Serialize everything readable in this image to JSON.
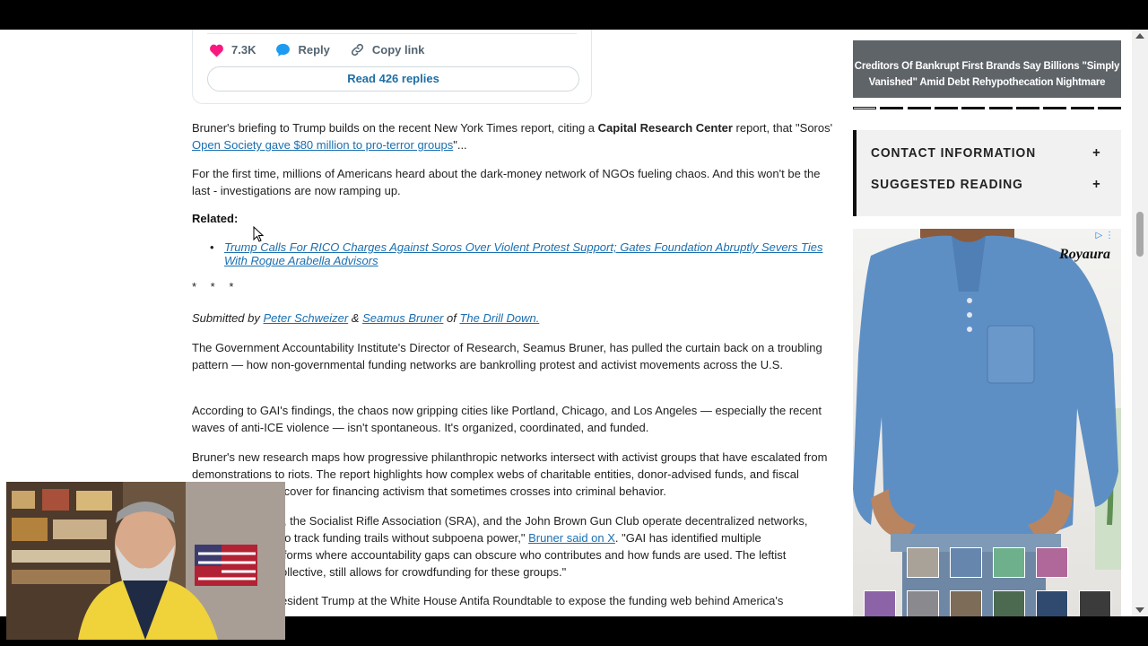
{
  "tweet": {
    "likes_count": "7.3K",
    "reply_label": "Reply",
    "copy_link_label": "Copy link",
    "read_replies_label": "Read 426 replies"
  },
  "article": {
    "p1_text_a": "Bruner's briefing to Trump builds on the recent New York Times report, citing a ",
    "p1_bold": "Capital Research Center",
    "p1_text_b": " report, that \"Soros'",
    "p1_link": " Open Society gave $80 million to pro-terror groups",
    "p1_text_c": "\"...",
    "p2": "For the first time, millions of Americans heard about the dark-money network of NGOs fueling chaos. And this won't be the last - investigations are now ramping up.",
    "related_label": "Related:",
    "related_bullet": "•",
    "related_link": "Trump Calls For RICO Charges Against Soros Over Violent Protest Support; Gates Foundation Abruptly Severs Ties With Rogue Arabella Advisors",
    "separator": "* * *",
    "submitted_prefix": "Submitted by ",
    "author1": "Peter Schweizer",
    "amp": " & ",
    "author2": "Seamus Bruner",
    "of": " of ",
    "outlet": "The Drill Down.",
    "p3": "The Government Accountability Institute's Director of Research, Seamus Bruner, has pulled the curtain back on a troubling pattern — how non-governmental funding networks are bankrolling protest and activist movements across the U.S.",
    "p4": "According to GAI's findings, the chaos now gripping cities like Portland, Chicago, and Los Angeles — especially the recent waves of anti-ICE violence — isn't spontaneous. It's organized, coordinated, and funded.",
    "p5": "Bruner's new research maps how progressive philanthropic networks intersect with activist groups that have escalated from demonstrations to riots. The report highlights how complex webs of charitable entities, donor-advised funds, and fiscal sponsors provide cover for financing activism that sometimes crosses into criminal behavior.",
    "p6_a": "Groups like Antifa, the Socialist Rifle Association (SRA), and the John Brown Gun Club operate decentralized networks, making it difficult to track funding trails without subpoena power,\" ",
    "p6_link": "Bruner said on X",
    "p6_b": ". \"GAI has identified multiple crowdfunding platforms where accountability gaps can obscure who contributes and how funds are used. The leftist platform, Open Collective, still allows for crowdfunding for these groups.\"",
    "p7": "Bruner briefed President Trump at the White House Antifa Roundtable to expose the funding web behind America's"
  },
  "sidebar": {
    "promo_headline": "Creditors Of Bankrupt First Brands Say Billions \"Simply Vanished\" Amid Debt Rehypothecation Nightmare",
    "accordion": [
      {
        "label": "CONTACT INFORMATION",
        "toggle": "+"
      },
      {
        "label": "SUGGESTED READING",
        "toggle": "+"
      }
    ],
    "ad": {
      "brand": "Royaura",
      "adchoices": "▷ ⋮",
      "swatch_colors": [
        "#a9a299",
        "#6786ad",
        "#6fb08c",
        "#b0679a",
        "#8d63a8",
        "#8a8a8e",
        "#7d6c58",
        "#4c6a50",
        "#2f4a6e",
        "#3b3b3b"
      ]
    }
  },
  "colors": {
    "link": "#1a6fb0",
    "like_heart": "#f91880",
    "reply_bubble": "#1d9bf0"
  }
}
